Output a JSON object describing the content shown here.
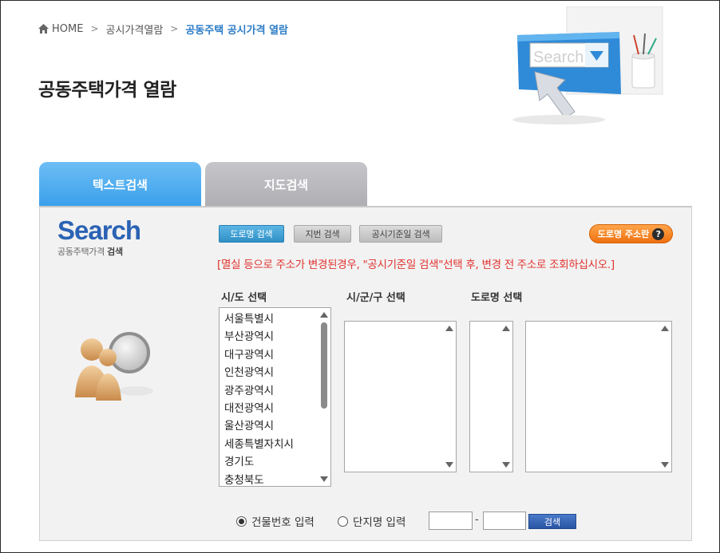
{
  "breadcrumb": {
    "home": "HOME",
    "level1": "공시가격열람",
    "current": "공동주택 공시가격 열람",
    "separator": ">"
  },
  "page": {
    "title": "공동주택가격 열람"
  },
  "hero": {
    "search_word": "Search",
    "icon": "search-hand-illustration"
  },
  "tabs": [
    {
      "label": "텍스트검색",
      "active": true
    },
    {
      "label": "지도검색",
      "active": false
    }
  ],
  "logo": {
    "word": "Search",
    "sub_prefix": "공동주택가격 ",
    "sub_bold": "검색"
  },
  "methods": {
    "road": "도로명 검색",
    "lot": "지번 검색",
    "base": "공시기준일 검색"
  },
  "address_help": {
    "label": "도로명 주소란",
    "icon_glyph": "?"
  },
  "notice": "[멸실 등으로 주소가 변경된경우, \"공시기준일 검색\"선택 후, 변경 전 주소로 조회하십시오.]",
  "columns": {
    "sido": "시/도 선택",
    "sigungu": "시/군/구 선택",
    "road": "도로명 선택"
  },
  "sido_options": [
    "서울특별시",
    "부산광역시",
    "대구광역시",
    "인천광역시",
    "광주광역시",
    "대전광역시",
    "울산광역시",
    "세종특별자치시",
    "경기도",
    "충청북도"
  ],
  "bottom": {
    "radio_building": "건물번호 입력",
    "radio_complex": "단지명 입력",
    "building_selected": true,
    "input1": "",
    "input2": "",
    "dash": "-",
    "search_button": "검색"
  },
  "colors": {
    "active_tab": "#3aa0ea",
    "inactive_tab": "#aeaeb3",
    "notice": "#e0322e",
    "brand_blue": "#2b63b4",
    "orange": "#ee7010"
  }
}
